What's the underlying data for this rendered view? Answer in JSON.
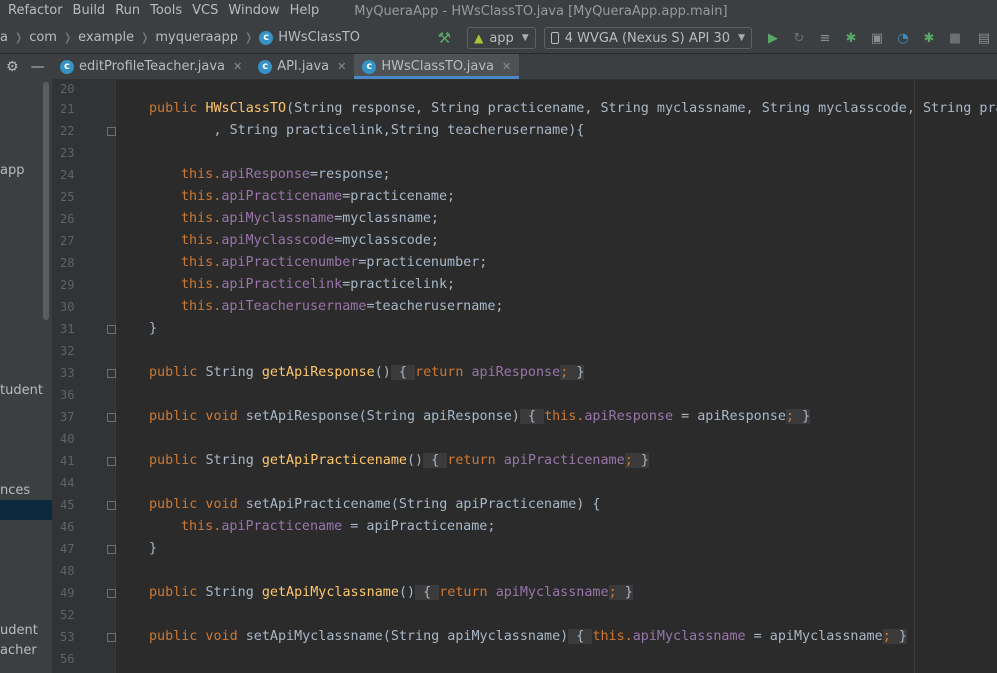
{
  "menu": {
    "items": [
      "Refactor",
      "Build",
      "Run",
      "Tools",
      "VCS",
      "Window",
      "Help"
    ],
    "title": "MyQueraApp - HWsClassTO.java [MyQueraApp.app.main]"
  },
  "breadcrumb": {
    "items": [
      "a",
      "com",
      "example",
      "myqueraapp",
      "HWsClassTO"
    ]
  },
  "toolbar": {
    "config": "app",
    "device": "4  WVGA (Nexus S) API 30"
  },
  "project_panel": {
    "items": [
      "app",
      "tudent",
      "nces",
      "udent",
      "acher"
    ]
  },
  "tabs": [
    {
      "label": "editProfileTeacher.java",
      "active": false
    },
    {
      "label": "API.java",
      "active": false
    },
    {
      "label": "HWsClassTO.java",
      "active": true
    }
  ],
  "editor": {
    "line_numbers": [
      "20",
      "21",
      "22",
      "23",
      "24",
      "25",
      "26",
      "27",
      "28",
      "29",
      "30",
      "31",
      "32",
      "33",
      "36",
      "37",
      "40",
      "41",
      "44",
      "45",
      "46",
      "47",
      "48",
      "49",
      "52",
      "53",
      "56"
    ],
    "lines": {
      "l21": {
        "kw": "public ",
        "fn": "HWsClassTO",
        "rest": "(String response, String practicename, String myclassname, String myclasscode, String pra"
      },
      "l22": {
        "text": "        , String practicelink,String teacherusername){"
      },
      "l24": {
        "this": "this.",
        "field": "apiResponse",
        "rest": "=response;"
      },
      "l25": {
        "this": "this.",
        "field": "apiPracticename",
        "rest": "=practicename;"
      },
      "l26": {
        "this": "this.",
        "field": "apiMyclassname",
        "rest": "=myclassname;"
      },
      "l27": {
        "this": "this.",
        "field": "apiMyclasscode",
        "rest": "=myclasscode;"
      },
      "l28": {
        "this": "this.",
        "field": "apiPracticenumber",
        "rest": "=practicenumber;"
      },
      "l29": {
        "this": "this.",
        "field": "apiPracticelink",
        "rest": "=practicelink;"
      },
      "l30": {
        "this": "this.",
        "field": "apiTeacherusername",
        "rest": "=teacherusername;"
      },
      "l31": {
        "text": "}"
      },
      "l33": {
        "kw": "public ",
        "type": "String ",
        "fn": "getApiResponse",
        "paren": "()",
        "open": " { ",
        "ret": "return ",
        "field": "apiResponse",
        "semi": "; ",
        "close": "}"
      },
      "l37": {
        "kw": "public void ",
        "fn": "setApiResponse",
        "params": "(String apiResponse)",
        "open": " { ",
        "this": "this.",
        "field": "apiResponse",
        "rest": " = apiResponse",
        "semi": "; ",
        "close": "}"
      },
      "l41": {
        "kw": "public ",
        "type": "String ",
        "fn": "getApiPracticename",
        "paren": "()",
        "open": " { ",
        "ret": "return ",
        "field": "apiPracticename",
        "semi": "; ",
        "close": "}"
      },
      "l45": {
        "kw": "public void ",
        "fn": "setApiPracticename",
        "params": "(String apiPracticename) {"
      },
      "l46": {
        "this": "this.",
        "field": "apiPracticename",
        "rest": " = apiPracticename;"
      },
      "l47": {
        "text": "}"
      },
      "l49": {
        "kw": "public ",
        "type": "String ",
        "fn": "getApiMyclassname",
        "paren": "()",
        "open": " { ",
        "ret": "return ",
        "field": "apiMyclassname",
        "semi": "; ",
        "close": "}"
      },
      "l53": {
        "kw": "public void ",
        "fn": "setApiMyclassname",
        "params": "(String apiMyclassname)",
        "open": " { ",
        "this": "this.",
        "field": "apiMyclassname",
        "rest": " = apiMyclassname",
        "semi": "; ",
        "close": "}"
      }
    }
  },
  "colors": {
    "keyword": "#cc7832",
    "method": "#ffc66d",
    "field": "#9876aa",
    "text": "#a9b7c6",
    "accent": "#4a88c7"
  }
}
